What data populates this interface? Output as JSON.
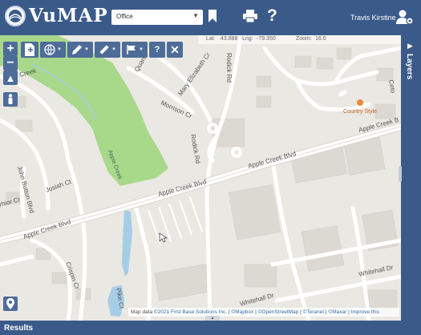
{
  "app": {
    "name": "VuMAP"
  },
  "header": {
    "office_select": {
      "value": "Office"
    },
    "user_name": "Travis Kirstine"
  },
  "coords": {
    "lat_label": "Lat:",
    "lat": "43.888",
    "lng_label": "Lng:",
    "lng": "-79.350",
    "zoom_label": "Zoom:",
    "zoom": "16.0"
  },
  "map": {
    "road_labels": {
      "apple_creek_main": "Apple Creek Blvd",
      "apple_creek_mid": "Apple Creek Blvd",
      "apple_creek_right": "Apple Creek B",
      "apple_creek_left": "Apple Creek Blvd",
      "rodick_top": "Rodick Rd",
      "rodick_mid": "Rodick Rd",
      "morrison": "Morrison Cr",
      "mary_elizabeth": "Mary Elizabeth Cr",
      "quartz": "Quartz",
      "john_button": "John Button Blvd",
      "josiah": "Josiah Ct",
      "whitehall_top": "Whitehall Dr",
      "whitehall_bottom": "Whitehall Dr",
      "crispin": "Crispin Cr",
      "pike": "Pike Ct",
      "creek": "Creek",
      "rhior": "rhior Cr",
      "ceto": "Ceto"
    },
    "park_label": "Apple Creek",
    "poi_label": "Country Style"
  },
  "attribution": {
    "prefix": "Map data ",
    "links": [
      "©2021 First Base Solutions Inc.",
      "©Mapbox",
      "©OpenStreetMap",
      "©Teranet",
      "©Maxar",
      "Improve this"
    ]
  },
  "sidebar": {
    "layers_label": "Layers"
  },
  "results": {
    "label": "Results"
  },
  "icons": {
    "logo": "globe-icon",
    "bookmark": "bookmark-icon",
    "print": "printer-icon",
    "help": "help-icon",
    "user_settings": "user-gear-icon"
  },
  "colors": {
    "header": "#3a5a8a",
    "tool_button": "#4d6c98",
    "park": "#a8d88a",
    "water": "#a6cde6",
    "map_bg": "#eae8e2"
  }
}
